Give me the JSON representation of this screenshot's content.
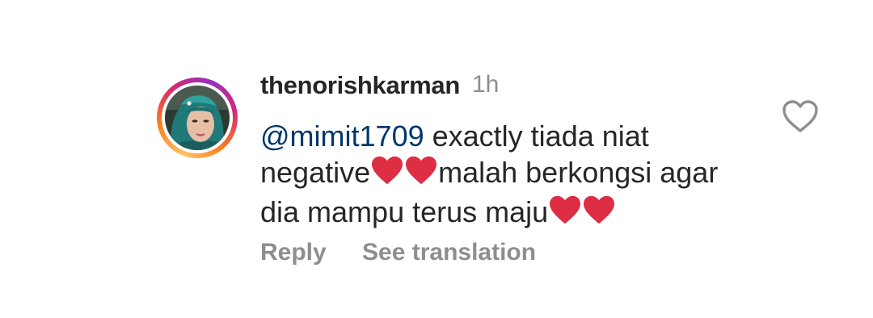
{
  "comment": {
    "username": "thenorishkarman",
    "time_ago": "1h",
    "mention": "@mimit1709",
    "line1_text": "exactly tiada niat",
    "line2_start": "negative",
    "line2_end": "malah berkongsi agar",
    "line3_text": "dia mampu terus maju",
    "heart_emoji_color": "#dd2e44"
  },
  "actions": {
    "reply_label": "Reply",
    "translation_label": "See translation"
  },
  "icons": {
    "like": "heart-outline-icon"
  },
  "colors": {
    "mention": "#00376b",
    "secondary_text": "#8e8e8e",
    "primary_text": "#262626"
  }
}
